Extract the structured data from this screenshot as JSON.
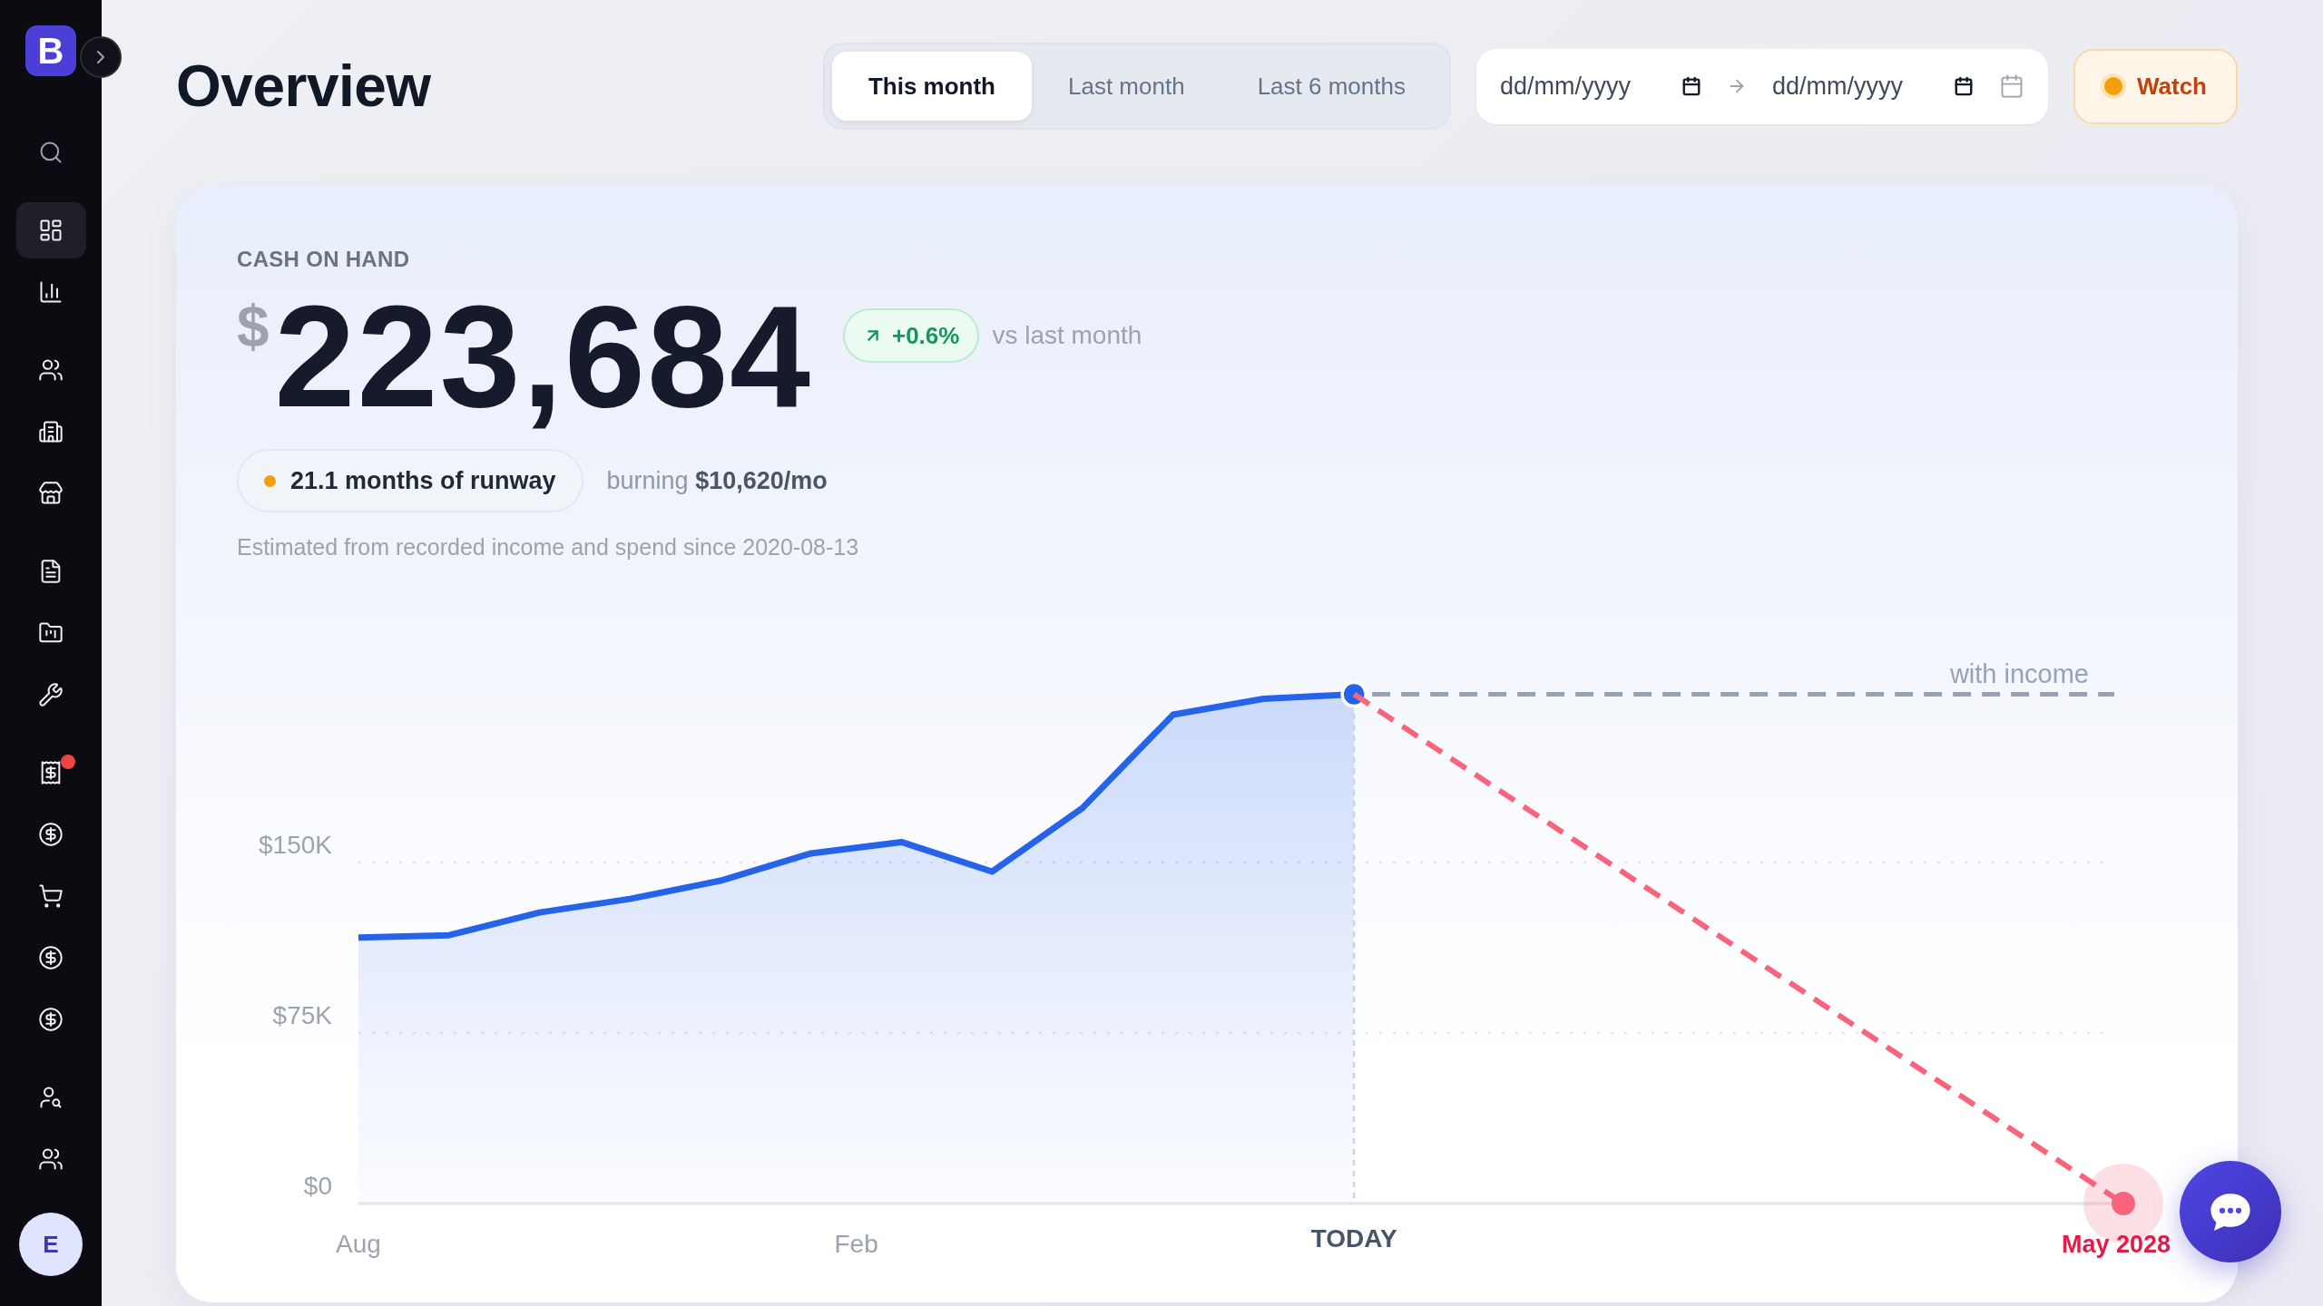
{
  "sidebar": {
    "logo": {
      "letter": "B"
    },
    "groups": [
      {
        "items": [
          {
            "kind": "search",
            "selected": false,
            "alert": false
          }
        ]
      },
      {
        "items": [
          {
            "kind": "dashboard",
            "selected": true,
            "alert": false
          },
          {
            "kind": "chart",
            "selected": false,
            "alert": false
          }
        ]
      },
      {
        "items": [
          {
            "kind": "people",
            "selected": false,
            "alert": false
          },
          {
            "kind": "building",
            "selected": false,
            "alert": false
          },
          {
            "kind": "store",
            "selected": false,
            "alert": false
          }
        ]
      },
      {
        "items": [
          {
            "kind": "document",
            "selected": false,
            "alert": false
          },
          {
            "kind": "folder",
            "selected": false,
            "alert": false
          },
          {
            "kind": "tools",
            "selected": false,
            "alert": false
          }
        ]
      },
      {
        "items": [
          {
            "kind": "receipt",
            "selected": false,
            "alert": true
          },
          {
            "kind": "payment",
            "selected": false,
            "alert": false
          },
          {
            "kind": "cart",
            "selected": false,
            "alert": false
          },
          {
            "kind": "payment",
            "selected": false,
            "alert": false
          },
          {
            "kind": "payment",
            "selected": false,
            "alert": false
          }
        ]
      },
      {
        "items": [
          {
            "kind": "lookup",
            "selected": false,
            "alert": false
          },
          {
            "kind": "people",
            "selected": false,
            "alert": false
          }
        ]
      }
    ],
    "avatar": {
      "initial": "E"
    }
  },
  "header": {
    "title": "Overview",
    "period_tabs": [
      {
        "label": "This month",
        "selected": true
      },
      {
        "label": "Last month",
        "selected": false
      },
      {
        "label": "Last 6 months",
        "selected": false
      }
    ],
    "date_range": {
      "start": {
        "placeholder": "dd/mm/yyyy"
      },
      "end": {
        "placeholder": "dd/mm/yyyy"
      }
    },
    "watch_button": {
      "label": "Watch"
    }
  },
  "cash_card": {
    "label": "CASH ON HAND",
    "currency": "$",
    "amount": "223,684",
    "change": {
      "value": "+0.6%",
      "positive": true
    },
    "comparison": "vs last month",
    "runway": {
      "label": "21.1 months of runway",
      "at_risk": true
    },
    "burn_rate": "burning **$10,620/mo**",
    "note": "Estimated from recorded income and spend since 2020-08-13",
    "chart_data": {
      "type": "line",
      "categories": [
        "Aug",
        null,
        null,
        null,
        null,
        null,
        null,
        null,
        null,
        null,
        null,
        "Feb",
        null,
        null,
        null,
        null,
        null,
        null,
        null,
        null,
        null,
        null,
        "TODAY",
        null,
        null,
        null,
        null,
        null,
        null,
        null,
        null,
        null,
        null,
        null,
        null,
        null,
        null,
        null,
        null,
        "May 2028"
      ],
      "ylim": [
        0,
        225000
      ],
      "yticks": [
        {
          "value": 0,
          "label": "$0"
        },
        {
          "value": 75000,
          "label": "$75K"
        },
        {
          "value": 150000,
          "label": "$150K"
        }
      ],
      "series": [
        {
          "color": "#2563eb",
          "line_style": "solid",
          "values": [
            117000,
            null,
            118000,
            null,
            128000,
            null,
            134000,
            null,
            142000,
            null,
            154000,
            null,
            159000,
            null,
            146000,
            null,
            174000,
            null,
            215000,
            null,
            222000,
            null,
            224000,
            null,
            null,
            null,
            null,
            null,
            null,
            null,
            null,
            null,
            null,
            null,
            null,
            null,
            null,
            null,
            null,
            null
          ]
        },
        {
          "color": "#f7647c",
          "line_style": "dashed",
          "values": [
            null,
            null,
            null,
            null,
            null,
            null,
            null,
            null,
            null,
            null,
            null,
            null,
            null,
            null,
            null,
            null,
            null,
            null,
            null,
            null,
            null,
            null,
            224000,
            null,
            null,
            null,
            null,
            null,
            null,
            null,
            null,
            null,
            null,
            null,
            null,
            null,
            null,
            null,
            null,
            0
          ]
        }
      ],
      "ref_lines": [
        {
          "axis": "y",
          "value": 224000,
          "label": "with income",
          "color": "#94a3b8"
        }
      ]
    }
  }
}
